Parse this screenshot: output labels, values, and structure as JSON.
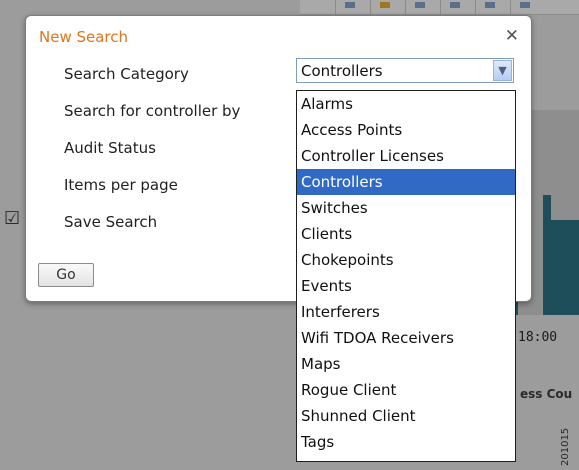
{
  "dialog": {
    "title": "New Search",
    "close_icon": "close-icon",
    "labels": {
      "search_category": "Search Category",
      "search_for_controller_by": "Search for controller by",
      "audit_status": "Audit Status",
      "items_per_page": "Items per page",
      "save_search": "Save Search"
    },
    "go_button": "Go"
  },
  "category_select": {
    "value": "Controllers",
    "arrow_icon": "chevron-down-icon",
    "options": [
      "Alarms",
      "Access Points",
      "Controller Licenses",
      "Controllers",
      "Switches",
      "Clients",
      "Chokepoints",
      "Events",
      "Interferers",
      "Wifi TDOA Receivers",
      "Maps",
      "Rogue Client",
      "Shunned Client",
      "Tags"
    ],
    "selected_index": 3,
    "highlight_color": "#316ac5"
  },
  "background": {
    "time_label": "18:00",
    "legend_fragment": "ess Cou",
    "watermark": "201015"
  },
  "colors": {
    "title": "#e0751a",
    "chart_fill": "#1d4e59"
  }
}
